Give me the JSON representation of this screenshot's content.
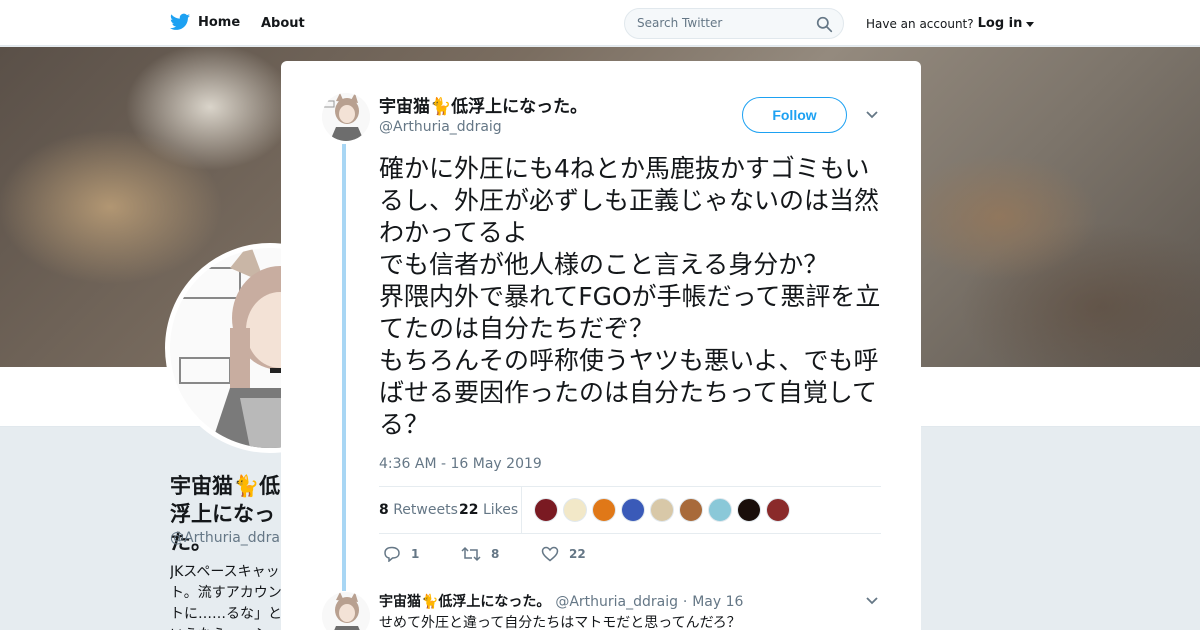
{
  "nav": {
    "home_label": "Home",
    "about_label": "About",
    "search_placeholder": "Search Twitter",
    "account_prompt": "Have an account?",
    "login_label": "Log in"
  },
  "background_profile": {
    "name": "宇宙猫🐈低浮上になった。",
    "handle": "@Arthuria_ddraig",
    "bio": "JKスペースキャット。流すアカウントに……るな」というなら……シュマロに返信し"
  },
  "tweet": {
    "display_name": "宇宙猫🐈低浮上になった。",
    "handle": "@Arthuria_ddraig",
    "follow_label": "Follow",
    "text": "確かに外圧にも4ねとか馬鹿抜かすゴミもいるし、外圧が必ずしも正義じゃないのは当然わかってるよ\nでも信者が他人様のこと言える身分か？\n界隈内外で暴れてFGOが手帳だって悪評を立てたのは自分たちだぞ？\nもちろんその呼称使うヤツも悪いよ、でも呼ばせる要因作ったのは自分たちって自覚してる？",
    "timestamp": "4:36 AM - 16 May 2019",
    "retweets_count": "8",
    "retweets_label": "Retweets",
    "likes_count": "22",
    "likes_label": "Likes",
    "reply_count": "1",
    "retweet_action_count": "8",
    "like_action_count": "22",
    "liker_colors": [
      "#7a1a22",
      "#f2e8c8",
      "#e07818",
      "#3a5ab8",
      "#d8c8a8",
      "#a86a3a",
      "#8ac8d8",
      "#1a0e0a",
      "#8a2a2a"
    ]
  },
  "reply": {
    "display_name": "宇宙猫🐈低浮上になった。",
    "handle": "@Arthuria_ddraig",
    "separator": "·",
    "date": "May 16",
    "text": "せめて外圧と違って自分たちはマトモだと思ってんだろ？"
  },
  "colors": {
    "brand_blue": "#1da1f2",
    "thread_line": "#a8d6f4",
    "muted_text": "#657786"
  }
}
